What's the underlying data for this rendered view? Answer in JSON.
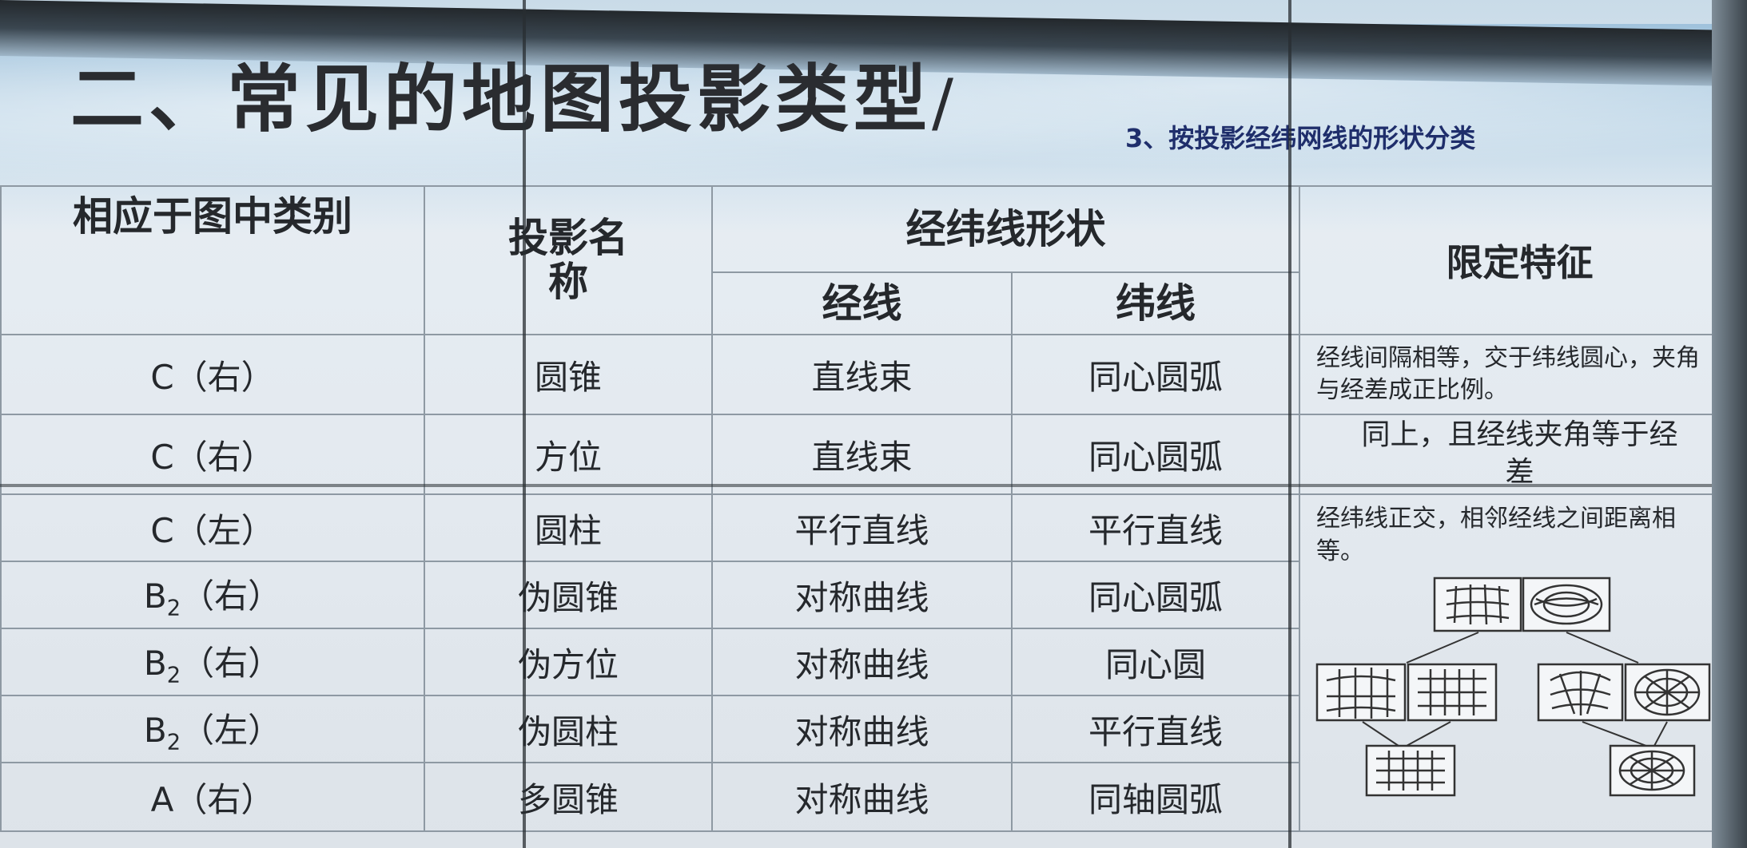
{
  "title": "二、常见的地图投影类型",
  "title_slash": "/",
  "subtitle": "3、按投影经纬网线的形状分类",
  "table": {
    "headers": {
      "category": "相应于图中类别",
      "name": "投影名称",
      "shape": "经纬线形状",
      "meridian": "经线",
      "parallel": "纬线",
      "feature": "限定特征"
    },
    "rows": [
      {
        "category": "C（右）",
        "name": "圆锥",
        "meridian": "直线束",
        "parallel": "同心圆弧"
      },
      {
        "category": "C（右）",
        "name": "方位",
        "meridian": "直线束",
        "parallel": "同心圆弧"
      },
      {
        "category": "C（左）",
        "name": "圆柱",
        "meridian": "平行直线",
        "parallel": "平行直线"
      },
      {
        "category_main": "B",
        "category_sub": "2",
        "category_side": "（右）",
        "name": "伪圆锥",
        "meridian": "对称曲线",
        "parallel": "同心圆弧"
      },
      {
        "category_main": "B",
        "category_sub": "2",
        "category_side": "（右）",
        "name": "伪方位",
        "meridian": "对称曲线",
        "parallel": "同心圆"
      },
      {
        "category_main": "B",
        "category_sub": "2",
        "category_side": "（左）",
        "name": "伪圆柱",
        "meridian": "对称曲线",
        "parallel": "平行直线"
      },
      {
        "category": "A（右）",
        "name": "多圆锥",
        "meridian": "对称曲线",
        "parallel": "同轴圆弧"
      }
    ],
    "features": {
      "conic": "经线间隔相等，交于纬线圆心，夹角与经差成正比例。",
      "azimuthal": "同上，且经线夹角等于经差",
      "cylindrical": "经纬线正交，相邻经线之间距离相等。"
    }
  },
  "diagram": {
    "description_icons": [
      "graticule-cylindrical-icon",
      "graticule-azimuthal-icon"
    ]
  }
}
